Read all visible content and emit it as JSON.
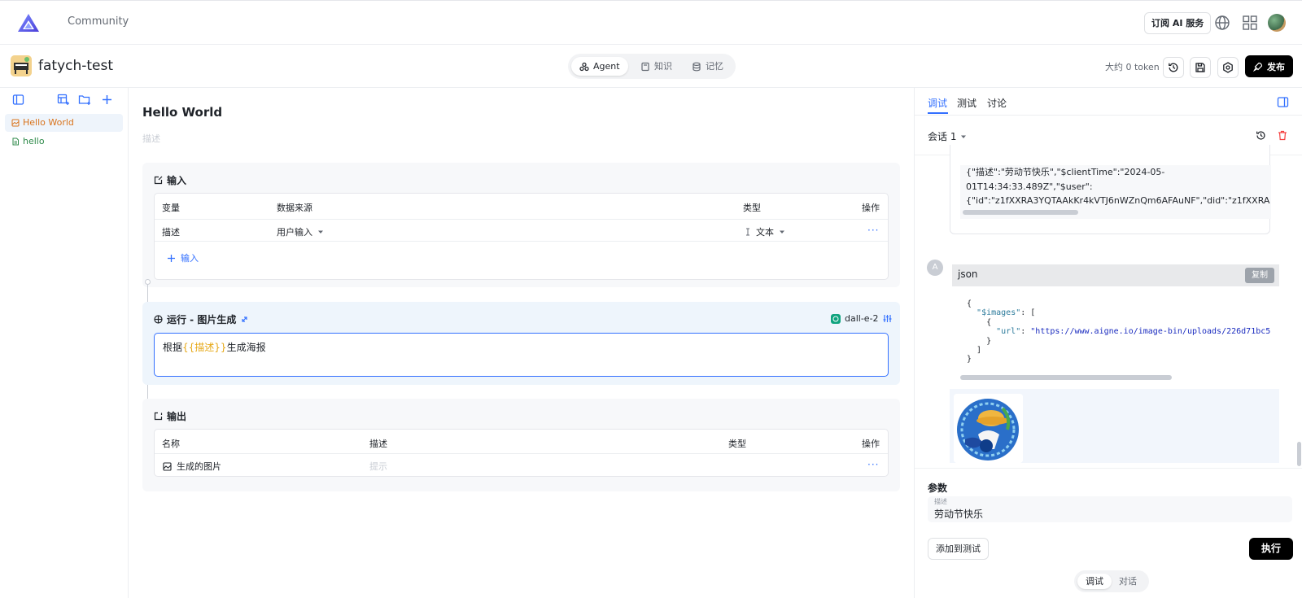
{
  "topnav": {
    "community": "Community",
    "subscribe_label": "订阅 AI 服务"
  },
  "project": {
    "name": "fatych-test",
    "tabs": [
      {
        "label": "Agent",
        "icon": "agent-icon",
        "active": true
      },
      {
        "label": "知识",
        "icon": "book-icon",
        "active": false
      },
      {
        "label": "记忆",
        "icon": "database-icon",
        "active": false
      }
    ],
    "token_label": "大约 0 token",
    "publish_label": "发布"
  },
  "sidebar": {
    "items": [
      {
        "label": "Hello World",
        "color": "#d9731b",
        "selected": true
      },
      {
        "label": "hello",
        "color": "#2e8a4a",
        "selected": false
      }
    ]
  },
  "main": {
    "title": "Hello World",
    "description_placeholder": "描述",
    "input_section": {
      "title": "输入",
      "headers": [
        "变量",
        "数据来源",
        "类型",
        "操作"
      ],
      "rows": [
        {
          "variable": "描述",
          "source": "用户输入",
          "type": "文本",
          "action": "···"
        }
      ],
      "add_label": "输入"
    },
    "run_section": {
      "title": "运行 - 图片生成",
      "model": "dall-e-2",
      "prompt_prefix": "根据",
      "prompt_var": "{{描述}}",
      "prompt_suffix": "生成海报"
    },
    "output_section": {
      "title": "输出",
      "headers": [
        "名称",
        "描述",
        "类型",
        "操作"
      ],
      "rows": [
        {
          "name": "生成的图片",
          "description_placeholder": "提示",
          "action": "···"
        }
      ]
    }
  },
  "right_panel": {
    "tabs": [
      "调试",
      "测试",
      "讨论"
    ],
    "active_tab": "调试",
    "session_label": "会话 1",
    "message1_lines": [
      "{\"描述\":\"劳动节快乐\",\"$clientTime\":\"2024-05-",
      "01T14:34:33.489Z\",\"$user\":",
      "{\"id\":\"z1fXXRA3YQTAAkKr4kVTJ6nWZnQm6AFAuNF\",\"did\":\"z1fXXRA"
    ],
    "assistant_avatar": "A",
    "code": {
      "language": "json",
      "copy_label": "复制",
      "key_images": "\"$images\"",
      "key_url": "\"url\"",
      "url_value": "\"https://www.aigne.io/image-bin/uploads/226d71bc5"
    },
    "params": {
      "title": "参数",
      "field_label": "描述",
      "field_value": "劳动节快乐",
      "add_to_test_label": "添加到测试",
      "run_label": "执行"
    },
    "mode": {
      "debug": "调试",
      "chat": "对话"
    }
  }
}
